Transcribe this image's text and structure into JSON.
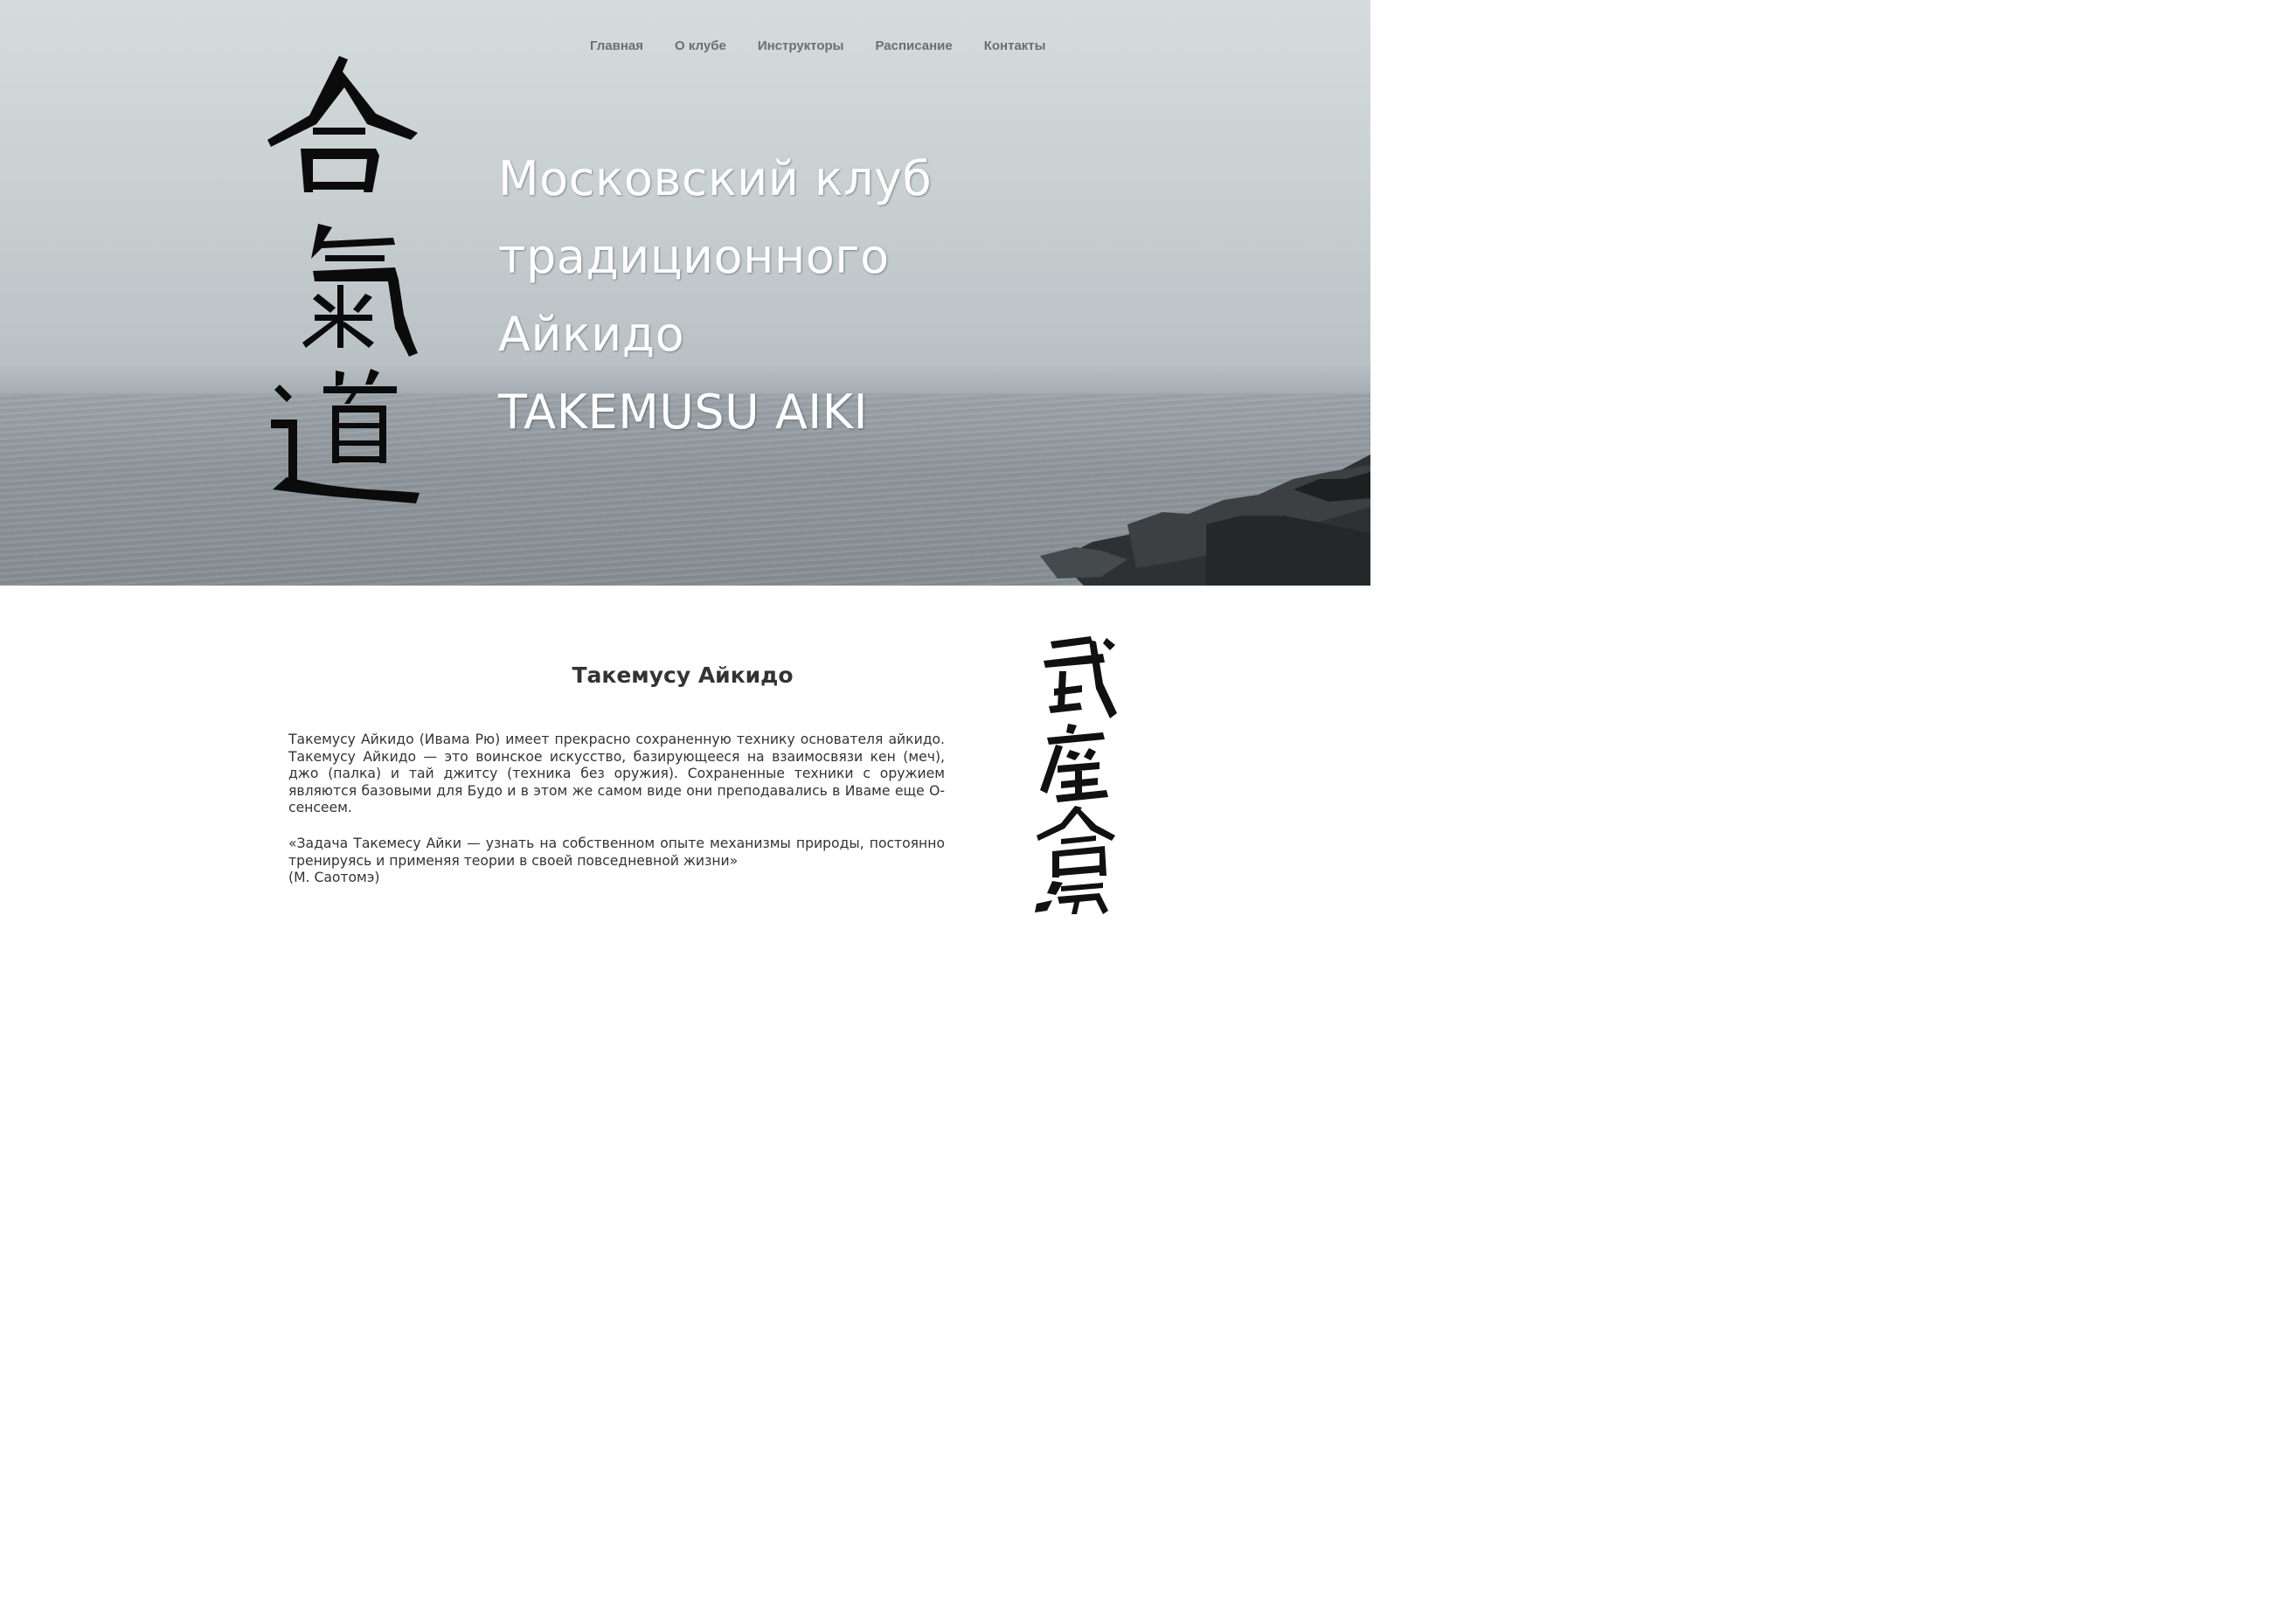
{
  "nav": {
    "items": [
      {
        "label": "Главная"
      },
      {
        "label": "О клубе"
      },
      {
        "label": "Инструкторы"
      },
      {
        "label": "Расписание"
      },
      {
        "label": "Контакты"
      }
    ]
  },
  "hero": {
    "title_lines": [
      "Московский клуб",
      "традиционного",
      "Айкидо",
      "TAKEMUSU AIKI"
    ],
    "calligraphy": "合氣道"
  },
  "content": {
    "section_title": "Такемусу Айкидо",
    "paragraph_1": "Такемусу Айкидо (Ивама Рю) имеет прекрасно сохраненную технику основателя айкидо. Такемусу Айкидо — это воинское искусство, базирующееся на взаимосвязи кен (меч), джо (палка) и тай джитсу (техника без оружия). Сохраненные техники с оружием являются базовыми для Будо и в этом же самом виде они преподавались в Иваме еще О-сенсеем.",
    "quote": "«Задача Такемесу Айки — узнать на собственном опыте механизмы природы, постоянно тренируясь и применяя теории в своей повседневной жизни»",
    "quote_author": "(М. Саотомэ)",
    "side_calligraphy": "武産合氣"
  }
}
